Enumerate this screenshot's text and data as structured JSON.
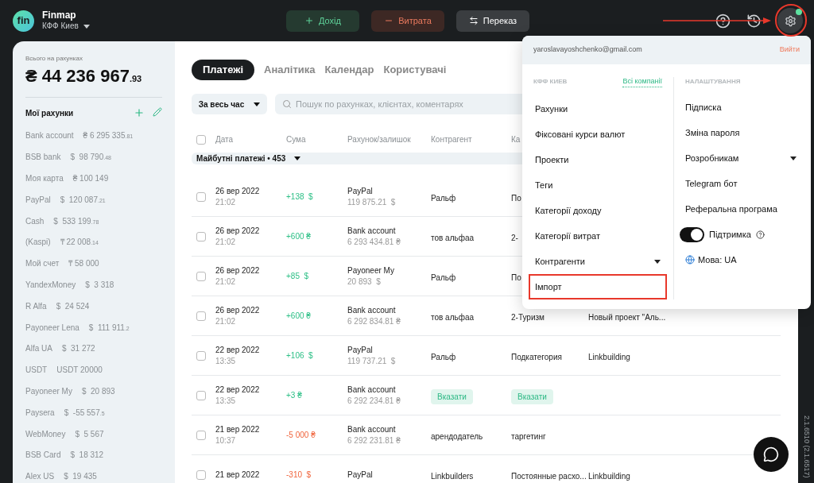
{
  "header": {
    "logo": "fin",
    "app_name": "Finmap",
    "company": "КФФ Киев",
    "actions": [
      {
        "kind": "income",
        "label": "Дохід"
      },
      {
        "kind": "expense",
        "label": "Витрата"
      },
      {
        "kind": "transfer",
        "label": "Переказ"
      }
    ],
    "settings_badge": true
  },
  "sidebar": {
    "total_label": "Всього на рахунках",
    "total": "₴ 44 236 967",
    "total_fraction": ".93",
    "accounts_title": "Мої рахунки",
    "accounts": [
      {
        "name": "Bank account",
        "amount": "₴ 6 295 335",
        "fraction": ".81"
      },
      {
        "name": "BSB bank",
        "amount": "$  98 790",
        "fraction": ".48"
      },
      {
        "name": "Моя карта",
        "amount": "₴ 100 149"
      },
      {
        "name": "PayPal",
        "amount": "$  120 087",
        "fraction": ".21"
      },
      {
        "name": "Cash",
        "amount": "$  533 199",
        "fraction": ".78"
      },
      {
        "name": "(Kaspi)",
        "amount": "₸ 22 008",
        "fraction": ".14"
      },
      {
        "name": "Мой счет",
        "amount": "₸ 58 000"
      },
      {
        "name": "YandexMoney",
        "amount": "$  3 318"
      },
      {
        "name": "R Alfa",
        "amount": "$  24 524"
      },
      {
        "name": "Payoneer Lena",
        "amount": "$  111 911",
        "fraction": ".2"
      },
      {
        "name": "Alfa UA",
        "amount": "$  31 272"
      },
      {
        "name": "USDT",
        "amount": "USDT 20000"
      },
      {
        "name": "Payoneer My",
        "amount": "$  20 893"
      },
      {
        "name": "Paysera",
        "amount": "$  -55 557",
        "fraction": ".5"
      },
      {
        "name": "WebMoney",
        "amount": "$  5 567"
      },
      {
        "name": "BSB Card",
        "amount": "$  18 312"
      },
      {
        "name": "Alex US",
        "amount": "$  19 435"
      }
    ]
  },
  "tabs": [
    {
      "label": "Платежі",
      "selected": true
    },
    {
      "label": "Аналітика",
      "selected": false
    },
    {
      "label": "Календар",
      "selected": false
    },
    {
      "label": "Користувачі",
      "selected": false
    }
  ],
  "period_filter": "За весь час",
  "search": {
    "placeholder": "Пошук по рахунках, клієнтах, коментарях"
  },
  "table": {
    "select_all_checked": false,
    "columns": [
      "Дата",
      "Сума",
      "Рахунок/залишок",
      "Контрагент",
      "Ка"
    ],
    "group": {
      "label": "Майбутні платежі • 453",
      "expanded": true
    },
    "rows": [
      {
        "checked": false,
        "date": "26 вер 2022",
        "time": "21:02",
        "amount": "+138  $",
        "kind": "income",
        "account": "PayPal",
        "balance": "119 875.21  $",
        "counterparty": {
          "text": "Ральф",
          "badge": false
        },
        "category": {
          "text": "По",
          "badge": false
        }
      },
      {
        "checked": false,
        "date": "26 вер 2022",
        "time": "21:02",
        "amount": "+600 ₴",
        "kind": "income",
        "account": "Bank account",
        "balance": "6 293 434.81 ₴",
        "counterparty": {
          "text": "тов альфаа",
          "badge": false
        },
        "category": {
          "text": "2-",
          "badge": false
        }
      },
      {
        "checked": false,
        "date": "26 вер 2022",
        "time": "21:02",
        "amount": "+85  $",
        "kind": "income",
        "account": "Payoneer My",
        "balance": "20 893  $",
        "counterparty": {
          "text": "Ральф",
          "badge": false
        },
        "category": {
          "text": "По",
          "badge": false
        }
      },
      {
        "checked": false,
        "date": "26 вер 2022",
        "time": "21:02",
        "amount": "+600 ₴",
        "kind": "income",
        "account": "Bank account",
        "balance": "6 292 834.81 ₴",
        "counterparty": {
          "text": "тов альфаа",
          "badge": false
        },
        "category": {
          "text": "2-Туризм",
          "badge": false
        },
        "project": "Новый проект \"Аль..."
      },
      {
        "checked": false,
        "date": "22 вер 2022",
        "time": "13:35",
        "amount": "+106  $",
        "kind": "income",
        "account": "PayPal",
        "balance": "119 737.21  $",
        "counterparty": {
          "text": "Ральф",
          "badge": false
        },
        "category": {
          "text": "Подкатегория",
          "badge": false
        },
        "project": "Linkbuilding"
      },
      {
        "checked": false,
        "date": "22 вер 2022",
        "time": "13:35",
        "amount": "+3 ₴",
        "kind": "income",
        "account": "Bank account",
        "balance": "6 292 234.81 ₴",
        "counterparty": {
          "text": "Вказати",
          "badge": true
        },
        "category": {
          "text": "Вказати",
          "badge": true
        }
      },
      {
        "checked": false,
        "date": "21 вер 2022",
        "time": "10:37",
        "amount": "-5 000 ₴",
        "kind": "expense",
        "account": "Bank account",
        "balance": "6 292 231.81 ₴",
        "counterparty": {
          "text": "арендодатель",
          "badge": false
        },
        "category": {
          "text": "таргетинг",
          "badge": false
        }
      },
      {
        "checked": false,
        "date": "21 вер 2022",
        "amount": "-310  $",
        "kind": "expense",
        "account": "PayPal",
        "counterparty": {
          "text": "Linkbuilders",
          "badge": false
        },
        "category": {
          "text": "Постоянные расхо...",
          "badge": false
        },
        "project": "Linkbuilding"
      }
    ]
  },
  "version": "2.1.6510 (2.1.6517)",
  "settings_menu": {
    "email": "yaroslavayoshchenko@gmail.com",
    "logout": "Вийти",
    "company_section": "КФФ КИЕВ",
    "all_companies": "Всі компанії",
    "company_items": [
      {
        "label": "Рахунки",
        "kind": "link",
        "highlighted": false
      },
      {
        "label": "Фіксовані курси валют",
        "kind": "link",
        "highlighted": false
      },
      {
        "label": "Проекти",
        "kind": "link",
        "highlighted": false
      },
      {
        "label": "Теги",
        "kind": "link",
        "highlighted": false
      },
      {
        "label": "Категорії доходу",
        "kind": "link",
        "highlighted": false
      },
      {
        "label": "Категорії витрат",
        "kind": "link",
        "highlighted": false
      },
      {
        "label": "Контрагенти",
        "kind": "dropdown",
        "highlighted": false
      },
      {
        "label": "Імпорт",
        "kind": "link",
        "highlighted": true
      }
    ],
    "settings_section": "НАЛАШТУВАННЯ",
    "settings_items": [
      {
        "label": "Підписка",
        "kind": "link"
      },
      {
        "label": "Зміна пароля",
        "kind": "link"
      },
      {
        "label": "Розробникам",
        "kind": "dropdown"
      },
      {
        "label": "Telegram бот",
        "kind": "link"
      },
      {
        "label": "Реферальна програма",
        "kind": "link"
      },
      {
        "label": "Підтримка",
        "kind": "toggle",
        "on": true
      },
      {
        "label": "Мова: UA",
        "kind": "language"
      }
    ]
  }
}
